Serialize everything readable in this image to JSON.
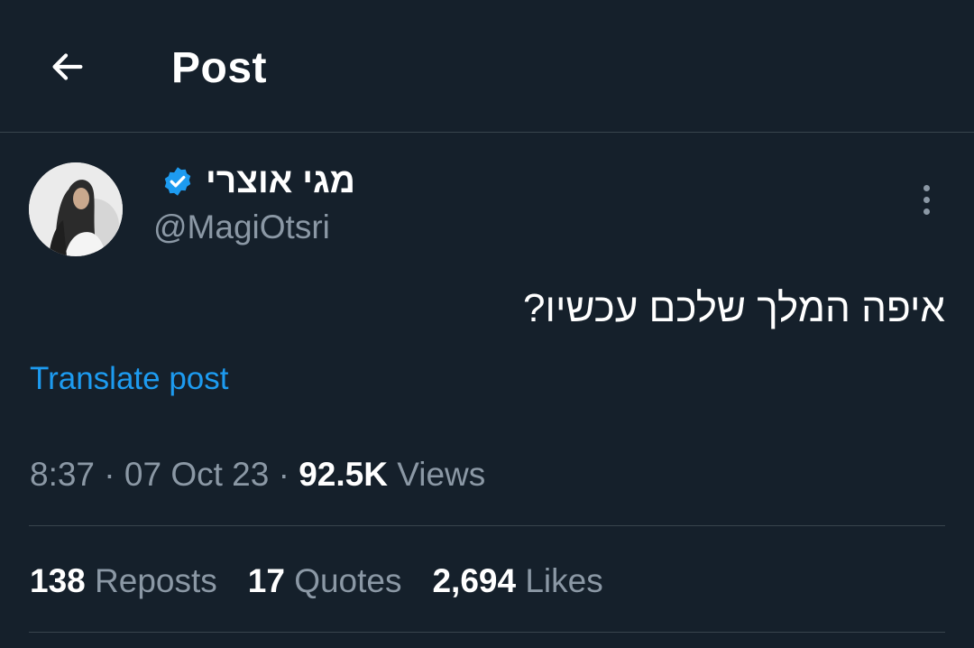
{
  "header": {
    "title": "Post",
    "back_icon": "arrow-left-icon"
  },
  "author": {
    "display_name": "מגי אוצרי",
    "handle": "@MagiOtsri",
    "verified_icon": "verified-badge-icon",
    "verified_color": "#1d9bf0"
  },
  "post": {
    "text": "איפה המלך שלכם עכשיו?",
    "translate_label": "Translate post",
    "time": "8:37",
    "separator": "·",
    "date": "07 Oct 23",
    "views_count": "92.5K",
    "views_label": "Views"
  },
  "stats": {
    "reposts_count": "138",
    "reposts_label": "Reposts",
    "quotes_count": "17",
    "quotes_label": "Quotes",
    "likes_count": "2,694",
    "likes_label": "Likes"
  },
  "colors": {
    "background": "#15202b",
    "divider": "#38444d",
    "secondary_text": "#8b98a5",
    "link": "#1d9bf0"
  }
}
